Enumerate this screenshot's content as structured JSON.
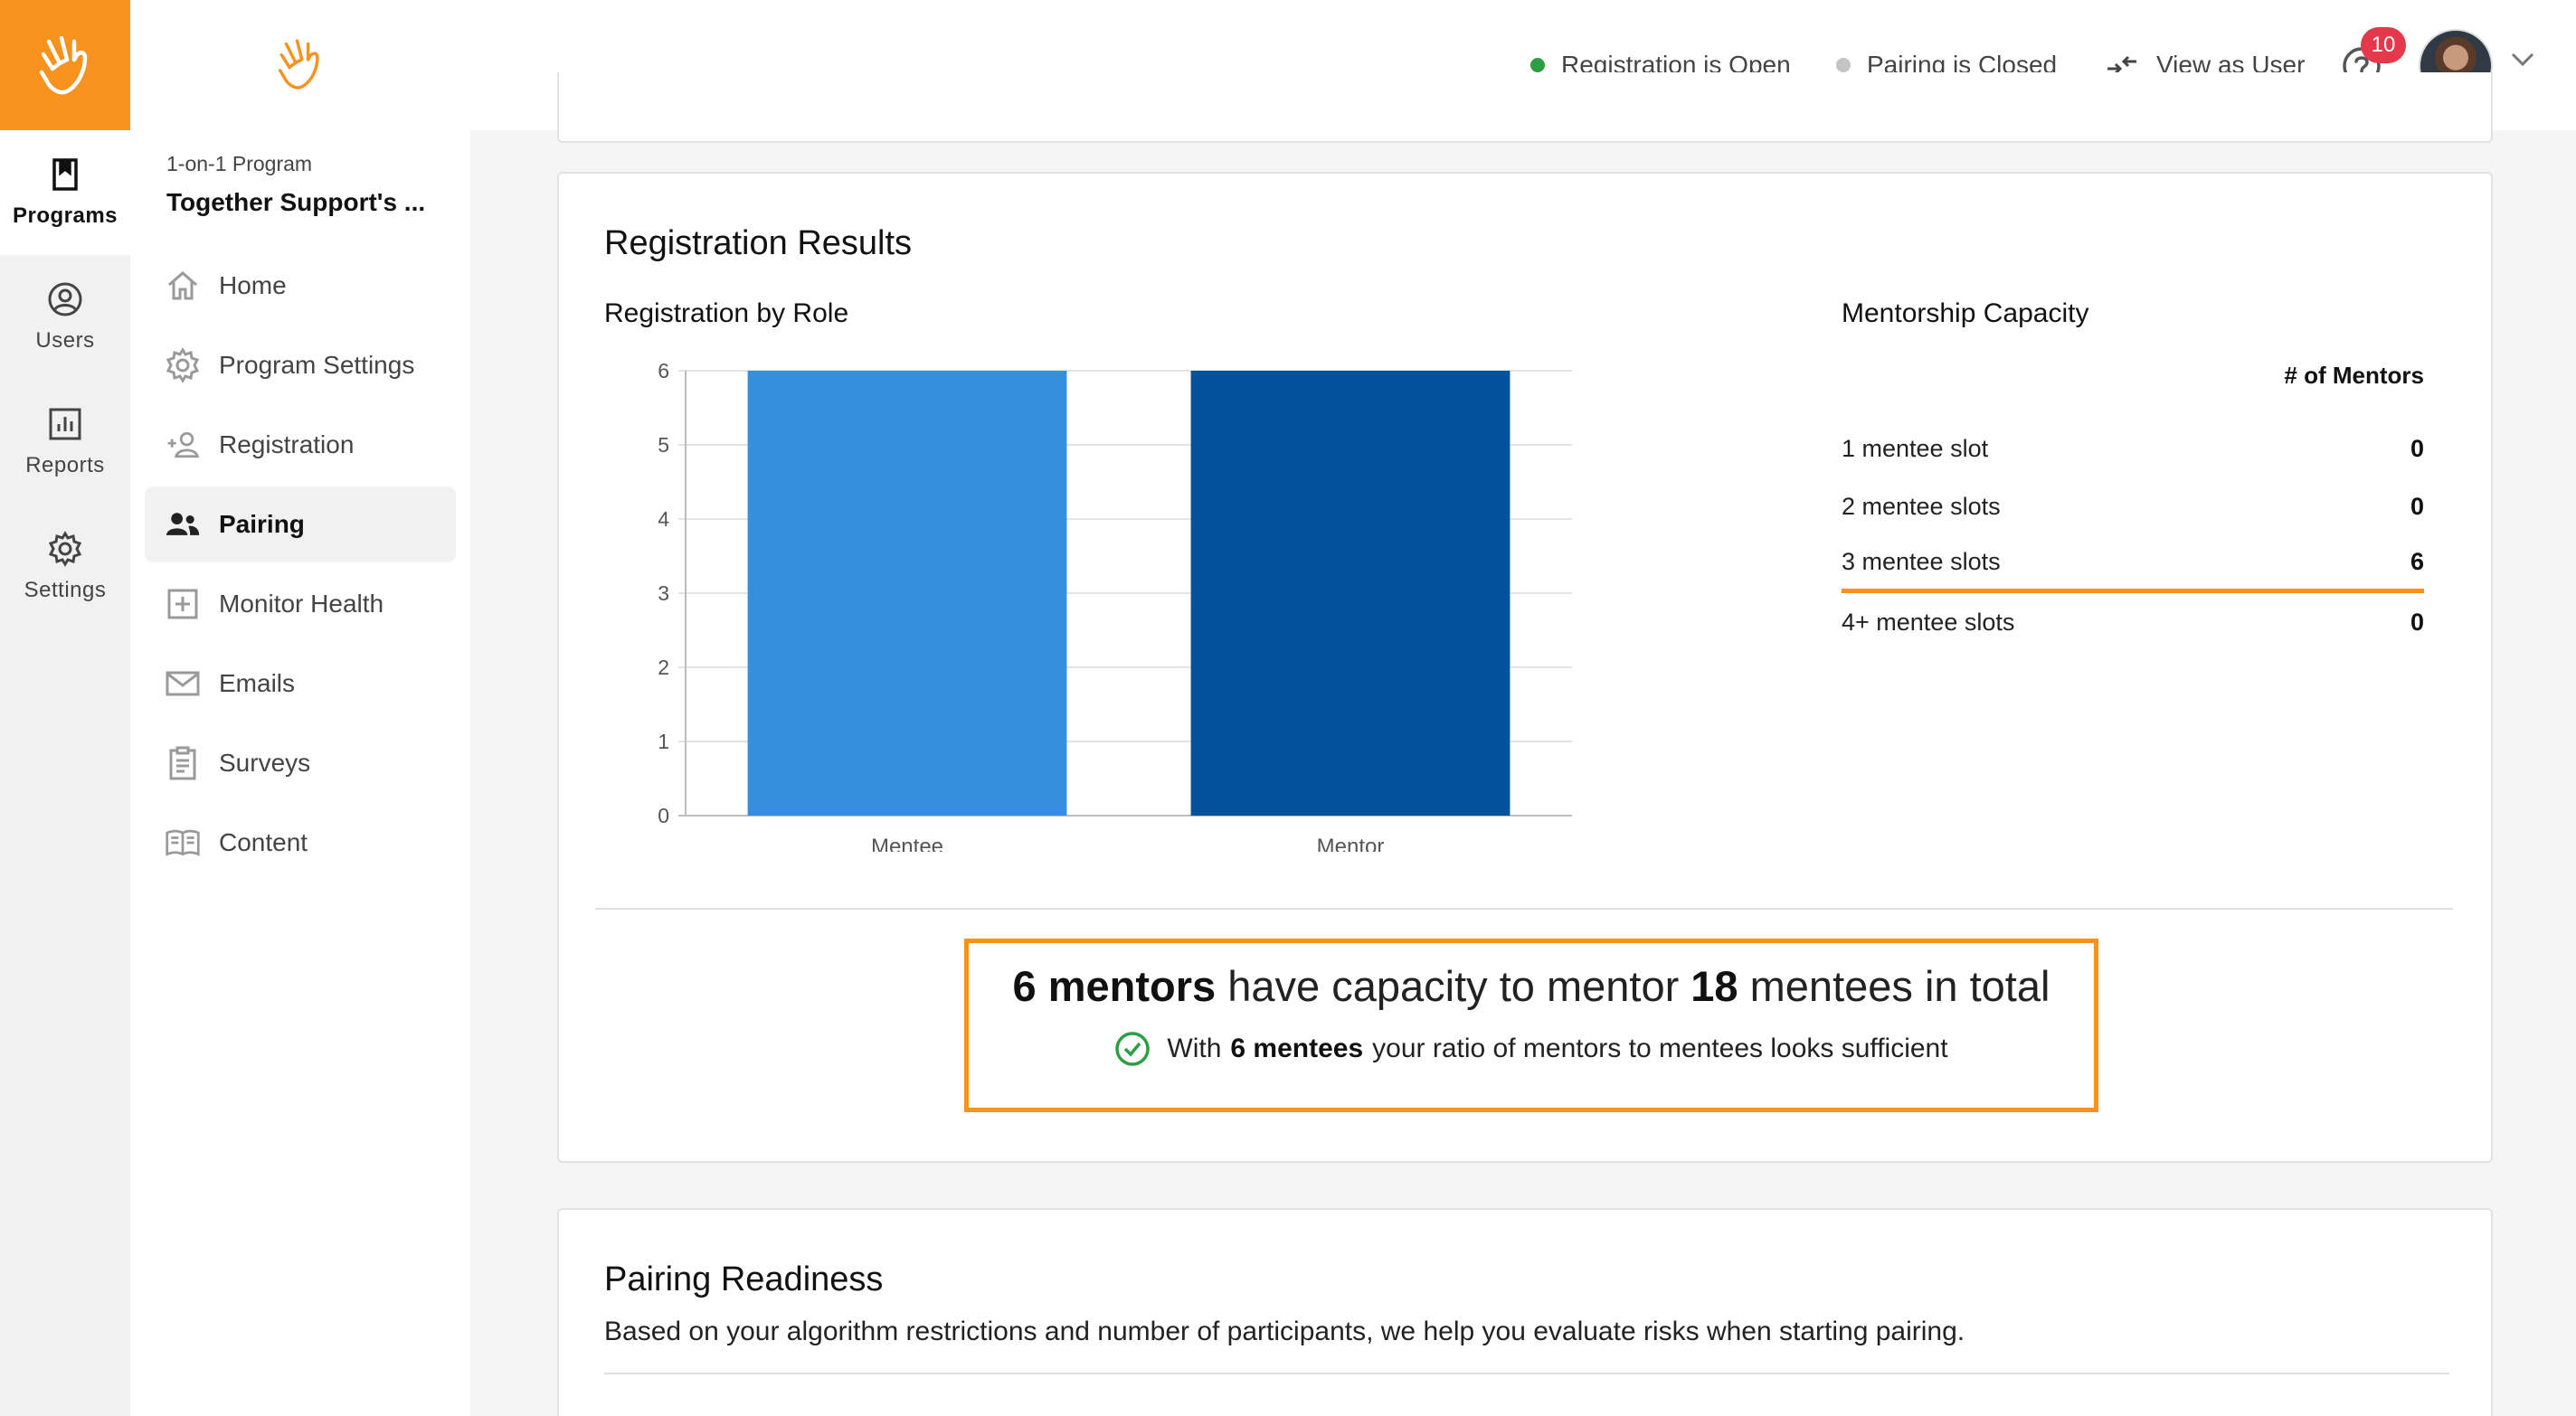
{
  "rail": {
    "items": [
      {
        "label": "Programs",
        "icon": "bookmark-icon",
        "active": true
      },
      {
        "label": "Users",
        "icon": "user-circle-icon"
      },
      {
        "label": "Reports",
        "icon": "chart-icon"
      },
      {
        "label": "Settings",
        "icon": "gear-icon"
      }
    ]
  },
  "sidebar": {
    "program_kind": "1-on-1 Program",
    "program_name": "Together Support's ...",
    "nav": [
      {
        "label": "Home",
        "icon": "home-icon"
      },
      {
        "label": "Program Settings",
        "icon": "gear-icon"
      },
      {
        "label": "Registration",
        "icon": "add-user-icon"
      },
      {
        "label": "Pairing",
        "icon": "users-icon",
        "active": true
      },
      {
        "label": "Monitor Health",
        "icon": "health-plus-icon"
      },
      {
        "label": "Emails",
        "icon": "mail-icon"
      },
      {
        "label": "Surveys",
        "icon": "clipboard-icon"
      },
      {
        "label": "Content",
        "icon": "book-icon"
      }
    ]
  },
  "topbar": {
    "registration_status": "Registration is Open",
    "pairing_status": "Pairing is Closed",
    "view_as_user": "View as User",
    "notification_count": "10",
    "colors": {
      "open": "#2e9e44",
      "closed": "#c4c4c4"
    }
  },
  "results": {
    "title": "Registration Results",
    "chart_title": "Registration by Role",
    "capacity": {
      "title": "Mentorship Capacity",
      "header": "# of Mentors",
      "rows": [
        {
          "label": "1 mentee slot",
          "value": "0"
        },
        {
          "label": "2 mentee slots",
          "value": "0"
        },
        {
          "label": "3 mentee slots",
          "value": "6"
        },
        {
          "label": "4+ mentee slots",
          "value": "0"
        }
      ]
    },
    "summary": {
      "mentors_bold": "6 mentors",
      "mid_text": " have capacity to mentor ",
      "mentees_bold": "18",
      "end_text": " mentees in total",
      "sub_prefix": "With",
      "sub_bold": "6 mentees",
      "sub_suffix": "your ratio of mentors to mentees looks sufficient"
    }
  },
  "readiness": {
    "title": "Pairing Readiness",
    "description": "Based on your algorithm restrictions and number of participants, we help you evaluate risks when starting pairing."
  },
  "chart_data": {
    "type": "bar",
    "categories": [
      "Mentee",
      "Mentor"
    ],
    "values": [
      6,
      6
    ],
    "colors": [
      "#358fde",
      "#02529c"
    ],
    "ylim": [
      0,
      6
    ],
    "yticks": [
      0,
      1,
      2,
      3,
      4,
      5,
      6
    ],
    "grid": true
  }
}
